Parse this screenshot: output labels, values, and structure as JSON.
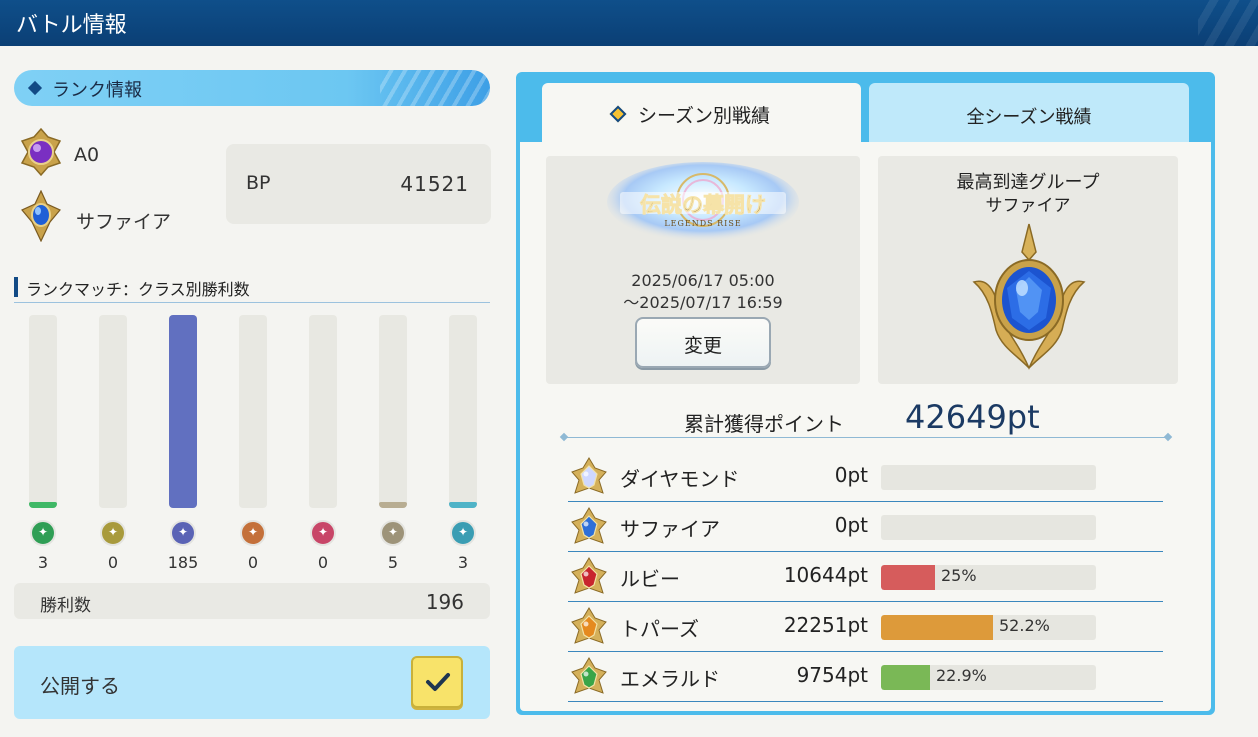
{
  "header": {
    "title": "バトル情報"
  },
  "rank_panel": {
    "section_title": "ランク情報",
    "rank": "A0",
    "group": "サファイア",
    "bp_label": "BP",
    "bp_value": "41521"
  },
  "class_wins": {
    "section_title": "ランクマッチ：クラス別勝利数",
    "classes": [
      {
        "icon": "leaf-icon",
        "count": "3",
        "fill": 0.032,
        "color": "#3fb866",
        "icon_color": "#2f9e55"
      },
      {
        "icon": "crown-icon",
        "count": "0",
        "fill": 0,
        "color": "#d9c95a",
        "icon_color": "#a89a3c"
      },
      {
        "icon": "rune-icon",
        "count": "185",
        "fill": 1.0,
        "color": "#6170c0",
        "icon_color": "#5a63b5"
      },
      {
        "icon": "dragon-icon",
        "count": "0",
        "fill": 0,
        "color": "#d9884a",
        "icon_color": "#c4703a"
      },
      {
        "icon": "bat-icon",
        "count": "0",
        "fill": 0,
        "color": "#d65a78",
        "icon_color": "#c84668"
      },
      {
        "icon": "cross-icon",
        "count": "5",
        "fill": 0.032,
        "color": "#b8ad92",
        "icon_color": "#9d9379"
      },
      {
        "icon": "gear-icon",
        "count": "3",
        "fill": 0.032,
        "color": "#4fb3c7",
        "icon_color": "#3a9db3"
      }
    ],
    "wins_label": "勝利数",
    "wins_value": "196"
  },
  "publish": {
    "label": "公開する",
    "checked": true
  },
  "tabs": {
    "season": "シーズン別戦績",
    "all": "全シーズン戦績"
  },
  "season": {
    "logo_text": "伝説の幕開け",
    "logo_sub": "LEGENDS RISE",
    "date_start": "2025/06/17 05:00",
    "date_end": "～2025/07/17 16:59",
    "change_button": "変更"
  },
  "best_group": {
    "title": "最高到達グループ",
    "name": "サファイア"
  },
  "total": {
    "label": "累計獲得ポイント",
    "value": "42649pt"
  },
  "points": [
    {
      "icon": "diamond-gem-icon",
      "name": "ダイヤモンド",
      "pts": "0pt",
      "pct_label": "",
      "pct": 0,
      "color": "#d9d9d3",
      "gem": "#cfd8ff"
    },
    {
      "icon": "sapphire-gem-icon",
      "name": "サファイア",
      "pts": "0pt",
      "pct_label": "",
      "pct": 0,
      "color": "#d9d9d3",
      "gem": "#2d6fd8"
    },
    {
      "icon": "ruby-gem-icon",
      "name": "ルビー",
      "pts": "10644pt",
      "pct_label": "25%",
      "pct": 0.25,
      "color": "#d65c5c",
      "gem": "#c8252e"
    },
    {
      "icon": "topaz-gem-icon",
      "name": "トパーズ",
      "pts": "22251pt",
      "pct_label": "52.2%",
      "pct": 0.522,
      "color": "#dd9a3a",
      "gem": "#e58a1f"
    },
    {
      "icon": "emerald-gem-icon",
      "name": "エメラルド",
      "pts": "9754pt",
      "pct_label": "22.9%",
      "pct": 0.229,
      "color": "#7ab856",
      "gem": "#3aa548"
    }
  ]
}
